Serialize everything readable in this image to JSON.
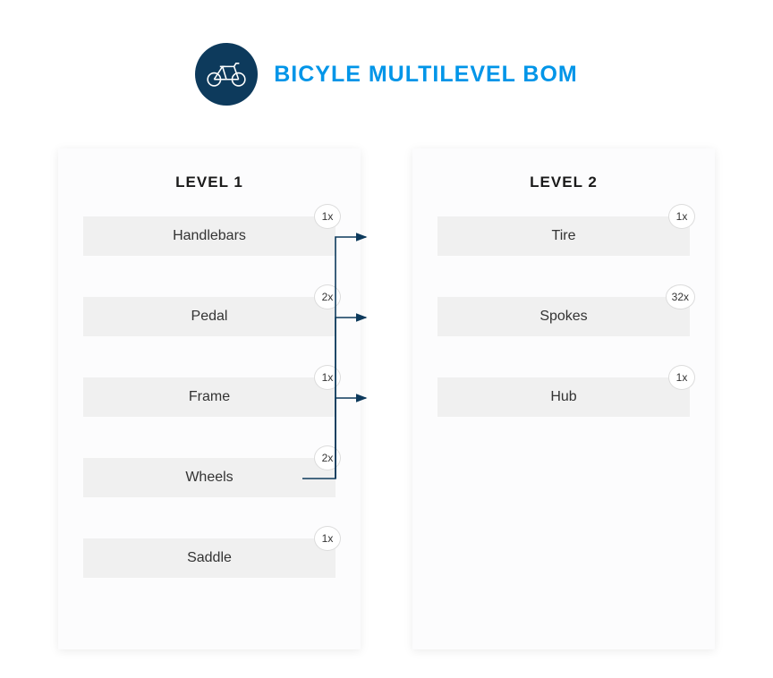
{
  "title": "BICYLE MULTILEVEL BOM",
  "level1": {
    "title": "LEVEL 1",
    "items": [
      {
        "name": "Handlebars",
        "qty": "1x"
      },
      {
        "name": "Pedal",
        "qty": "2x"
      },
      {
        "name": "Frame",
        "qty": "1x"
      },
      {
        "name": "Wheels",
        "qty": "2x"
      },
      {
        "name": "Saddle",
        "qty": "1x"
      }
    ]
  },
  "level2": {
    "title": "LEVEL 2",
    "items": [
      {
        "name": "Tire",
        "qty": "1x"
      },
      {
        "name": "Spokes",
        "qty": "32x"
      },
      {
        "name": "Hub",
        "qty": "1x"
      }
    ]
  },
  "colors": {
    "accent": "#0095e8",
    "dark": "#0d3a5c"
  }
}
